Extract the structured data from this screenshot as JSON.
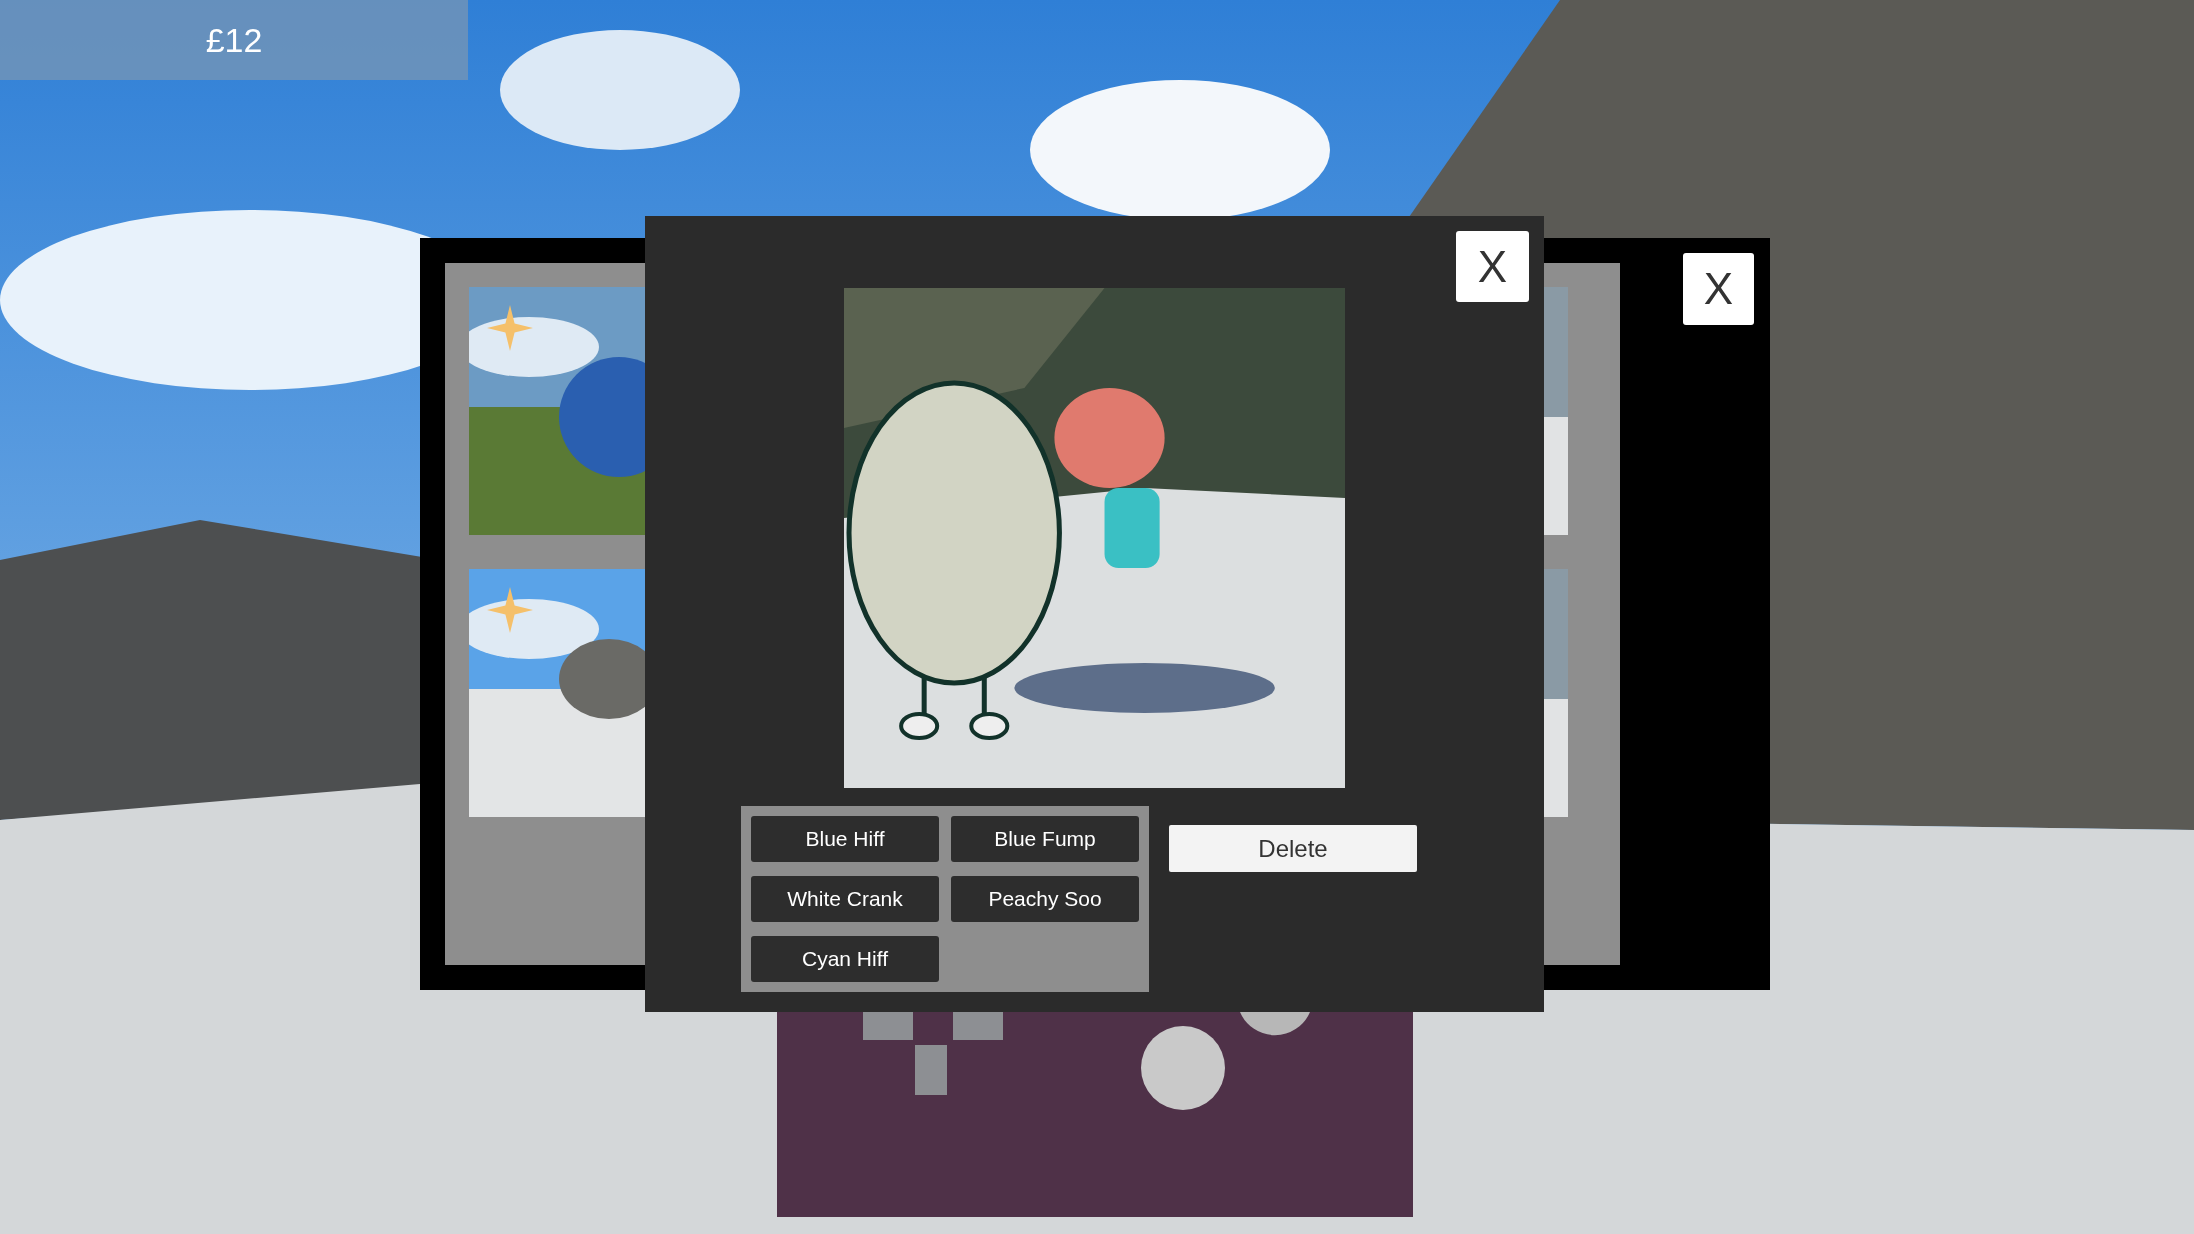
{
  "hud": {
    "money": "£12"
  },
  "back_window": {
    "close": "X",
    "thumbnails": [
      {
        "kind": "picture",
        "starred": true
      },
      {
        "kind": "picture",
        "starred": true
      }
    ],
    "right_thumbnails": [
      {
        "kind": "picture"
      },
      {
        "kind": "picture"
      }
    ]
  },
  "dialog": {
    "close": "X",
    "tags": [
      {
        "label": "Blue Hiff"
      },
      {
        "label": "Blue Fump"
      },
      {
        "label": "White Crank"
      },
      {
        "label": "Peachy Soo"
      },
      {
        "label": "Cyan Hiff"
      }
    ],
    "delete": "Delete"
  }
}
